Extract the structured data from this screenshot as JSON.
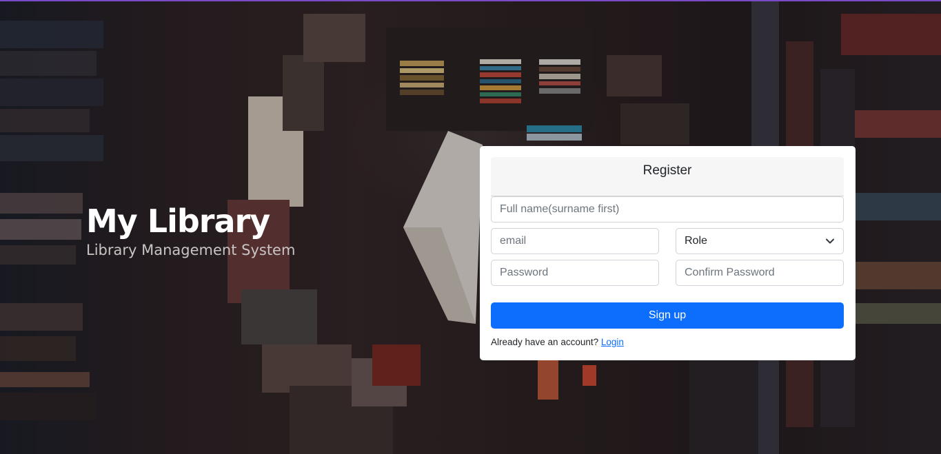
{
  "brand": {
    "title": "My Library",
    "subtitle": "Library Management System"
  },
  "register_form": {
    "heading": "Register",
    "full_name_placeholder": "Full name(surname first)",
    "email_placeholder": "email",
    "role_selected": "Role",
    "password_placeholder": "Password",
    "confirm_password_placeholder": "Confirm Password",
    "submit_label": "Sign up",
    "login_prompt": "Already have an account?",
    "login_link": "Login"
  },
  "colors": {
    "primary": "#0d6efd",
    "top_accent": "#7b4bc7"
  },
  "icons": {
    "role_dropdown": "chevron-down-icon"
  }
}
